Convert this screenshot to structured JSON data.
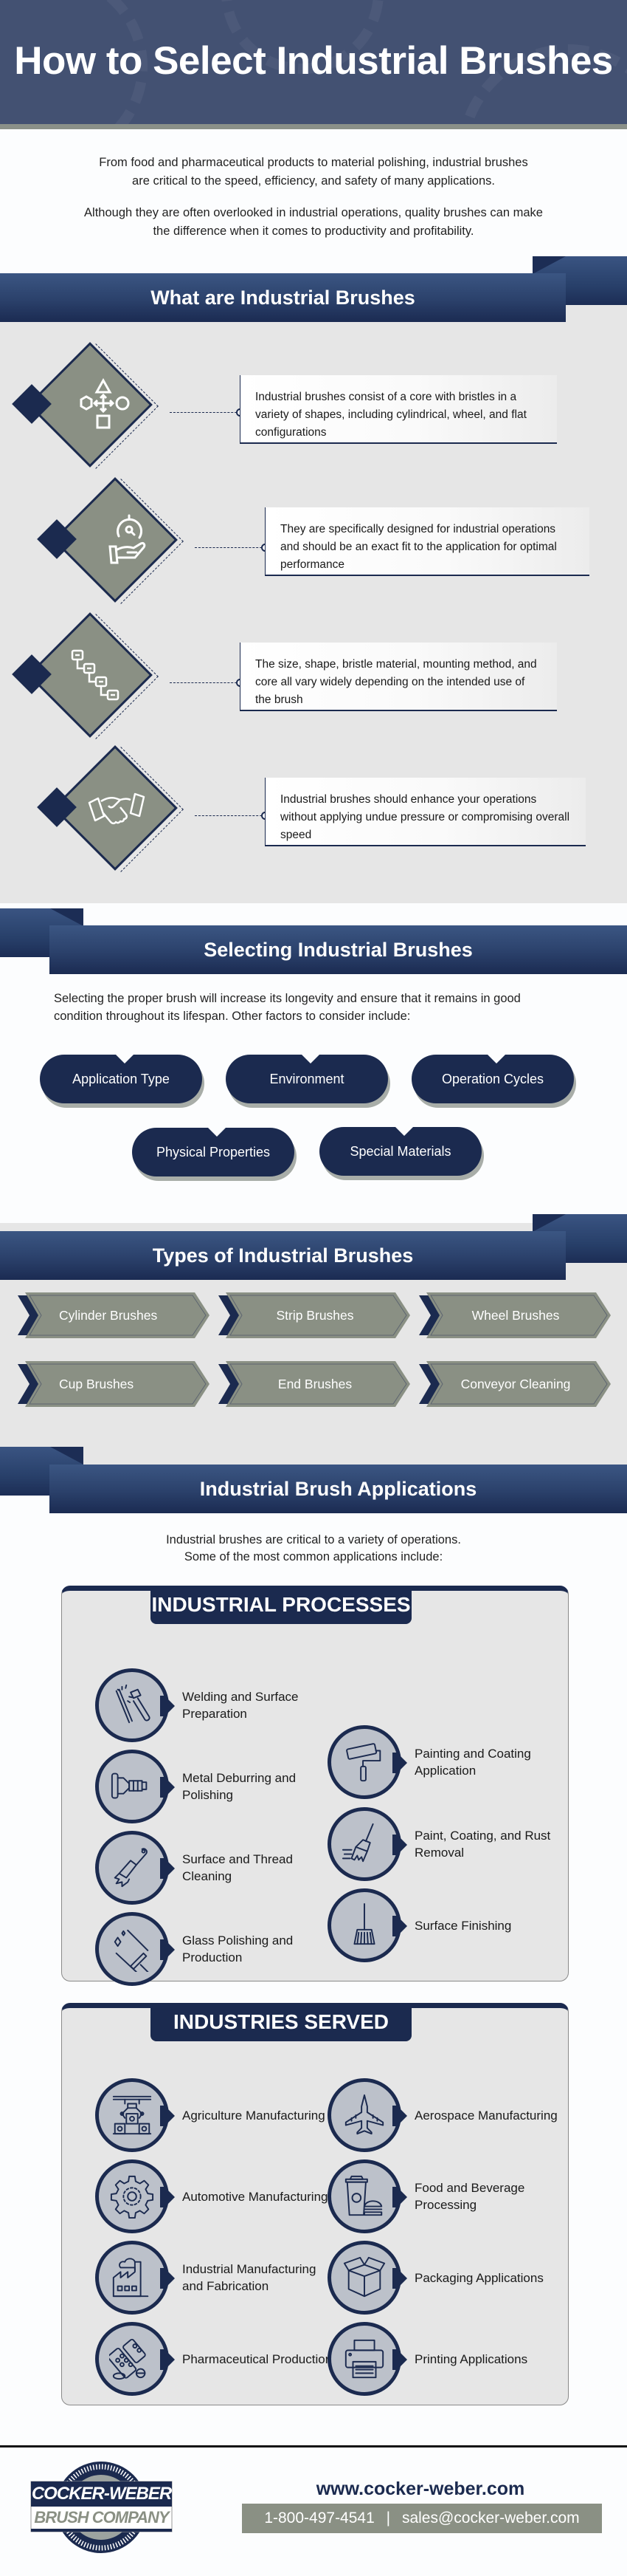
{
  "header": {
    "title": "How to Select Industrial Brushes"
  },
  "intro": {
    "paragraph_1_line_1": "From food and pharmaceutical products to material polishing, industrial brushes",
    "paragraph_1_line_2": "are critical to the speed, efficiency, and safety of many applications.",
    "paragraph_2_line_1": "Although they are often overlooked in industrial operations, quality brushes can make",
    "paragraph_2_line_2": "the difference when it comes to productivity and profitability."
  },
  "what_are": {
    "heading": "What are Industrial Brushes",
    "items": [
      {
        "icon": "shapes-icon",
        "text": "Industrial brushes consist of a core with bristles in a variety of shapes, including cylindrical, wheel, and flat configurations"
      },
      {
        "icon": "hand-gauge-icon",
        "text": "They are specifically designed for industrial operations and should be an exact fit to the application for optimal performance"
      },
      {
        "icon": "flowchart-icon",
        "text": "The size, shape, bristle material, mounting method, and core all vary widely depending on the intended use of the brush"
      },
      {
        "icon": "handshake-icon",
        "text": "Industrial brushes should enhance your operations without applying undue pressure or compromising overall speed"
      }
    ]
  },
  "selecting": {
    "heading": "Selecting Industrial Brushes",
    "text_line_1": "Selecting the proper brush will increase its longevity and ensure that it remains in good",
    "text_line_2": "condition throughout its lifespan. Other factors to consider include:",
    "factors": [
      "Application Type",
      "Environment",
      "Operation Cycles",
      "Physical Properties",
      "Special Materials"
    ]
  },
  "types": {
    "heading": "Types of Industrial Brushes",
    "items": [
      "Cylinder Brushes",
      "Strip Brushes",
      "Wheel Brushes",
      "Cup Brushes",
      "End Brushes",
      "Conveyor Cleaning"
    ]
  },
  "applications": {
    "heading": "Industrial Brush Applications",
    "intro_line_1": "Industrial brushes are critical to a variety of operations.",
    "intro_line_2": "Some of the most common applications include:",
    "processes": {
      "title": "INDUSTRIAL PROCESSES",
      "items": [
        {
          "icon": "welding-torch-icon",
          "label": "Welding and Surface Preparation"
        },
        {
          "icon": "paint-roller-icon",
          "label": "Painting and Coating Application"
        },
        {
          "icon": "wire-cup-brush-icon",
          "label": "Metal Deburring and Polishing"
        },
        {
          "icon": "paint-brush-icon",
          "label": "Paint, Coating, and Rust Removal"
        },
        {
          "icon": "scraper-brush-icon",
          "label": "Surface and Thread Cleaning"
        },
        {
          "icon": "broom-icon",
          "label": "Surface Finishing"
        },
        {
          "icon": "squeegee-icon",
          "label": "Glass Polishing and Production"
        }
      ]
    },
    "industries": {
      "title": "INDUSTRIES SERVED",
      "items": [
        {
          "icon": "robot-arm-icon",
          "label": "Agriculture Manufacturing"
        },
        {
          "icon": "airplane-icon",
          "label": "Aerospace Manufacturing"
        },
        {
          "icon": "gear-icon",
          "label": "Automotive Manufacturing"
        },
        {
          "icon": "food-drink-icon",
          "label": "Food and Beverage Processing"
        },
        {
          "icon": "factory-icon",
          "label": "Industrial Manufacturing and Fabrication"
        },
        {
          "icon": "box-icon",
          "label": "Packaging Applications"
        },
        {
          "icon": "pills-icon",
          "label": "Pharmaceutical Production"
        },
        {
          "icon": "printer-icon",
          "label": "Printing Applications"
        }
      ]
    }
  },
  "footer": {
    "logo_line_1": "COCKER-WEBER",
    "logo_line_2": "BRUSH COMPANY",
    "website": "www.cocker-weber.com",
    "phone": "1-800-497-4541",
    "separator": "|",
    "email": "sales@cocker-weber.com"
  },
  "colors": {
    "navy": "#1b2a4f",
    "header_blue": "#435172",
    "sage": "#8a9084",
    "light_gray": "#e6e6e6",
    "icon_circle": "#bcc1ca"
  }
}
